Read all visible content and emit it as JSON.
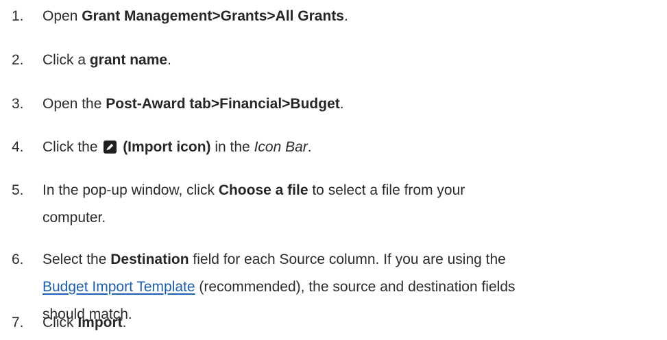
{
  "steps": [
    {
      "num": "1.",
      "pre": "Open ",
      "bold": "Grant Management>Grants>All Grants",
      "post": "."
    },
    {
      "num": "2.",
      "pre": "Click a ",
      "bold": "grant name",
      "post": "."
    },
    {
      "num": "3.",
      "pre": "Open the ",
      "bold": "Post-Award tab>Financial>Budget",
      "post": "."
    },
    {
      "num": "4.",
      "pre": "Click the ",
      "bold": " (Import icon)",
      "mid": " in the ",
      "italic": "Icon Bar",
      "post": ".",
      "icon": "import-icon"
    },
    {
      "num": "5.",
      "pre": "In the pop-up window, click ",
      "bold": "Choose a file",
      "post": " to select a file from your",
      "line2": "computer."
    },
    {
      "num": "6.",
      "pre": "Select the ",
      "bold": "Destination",
      "post": " field for each Source column. If you are using the",
      "link": "Budget Import Template",
      "line2_post": " (recommended), the source and destination fields",
      "line3": "should match."
    },
    {
      "num": "7.",
      "pre": "Click ",
      "bold": "Import",
      "post": "."
    }
  ]
}
